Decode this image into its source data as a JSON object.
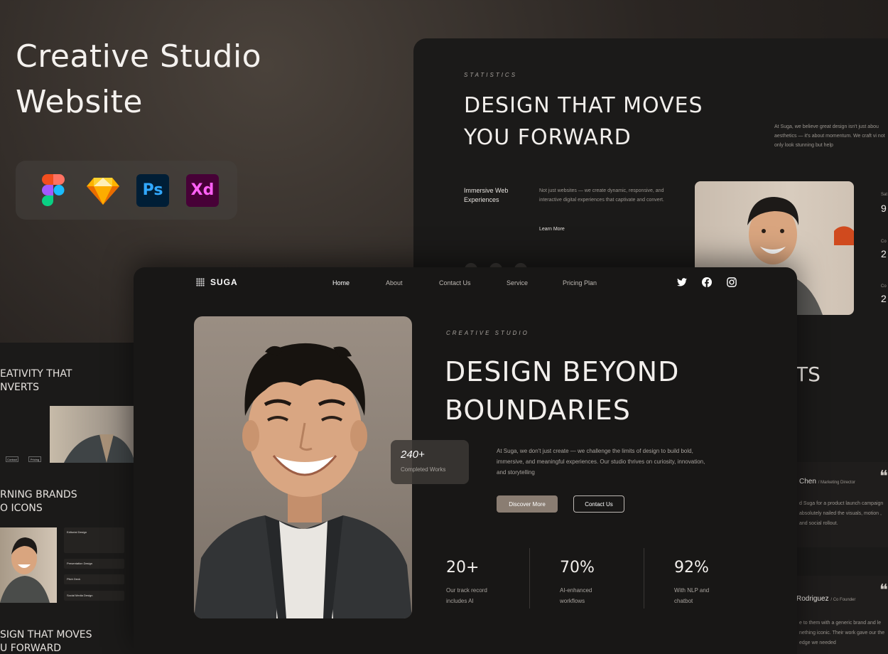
{
  "hero": {
    "title_line1": "Creative Studio",
    "title_line2": "Website"
  },
  "tools": [
    {
      "name": "figma-icon"
    },
    {
      "name": "sketch-icon"
    },
    {
      "name": "photoshop-icon",
      "label": "Ps"
    },
    {
      "name": "xd-icon",
      "label": "Xd"
    }
  ],
  "back_card": {
    "eyebrow": "STATISTICS",
    "title_line1": "DESIGN THAT MOVES",
    "title_line2": "YOU FORWARD",
    "intro": "At Suga, we believe great design isn't just abou aesthetics — it's about momentum. We craft vi not only look stunning but help",
    "feature_title": "Immersive Web Experiences",
    "feature_desc": "Not just websites — we create dynamic, responsive, and interactive digital experiences that captivate and convert.",
    "learn_more": "Learn More",
    "side_stats": [
      {
        "label": "Sat",
        "value": "9"
      },
      {
        "label": "Co",
        "value": "2"
      },
      {
        "label": "Co",
        "value": "2"
      }
    ]
  },
  "left_card": {
    "head1_line1": "EATIVITY THAT",
    "head1_line2": "NVERTS",
    "head2_line1": "RNING BRANDS",
    "head2_line2": "O ICONS",
    "head3_line1": "SIGN THAT MOVES",
    "head3_line2": "U FORWARD",
    "services": [
      "Editorial Design",
      "Presentation Design",
      "Pitch Deck",
      "Social Media Design"
    ],
    "btn_a": "Contact",
    "btn_b": "Pricing"
  },
  "right_card": {
    "heading_fragment": "TS",
    "t1_name": "Chen",
    "t1_role": "/ Marketing Director",
    "t1_text": "d Suga for a product launch campaign absolutely nailed the visuals, motion , and social rollout.",
    "t2_name": "Rodriguez",
    "t2_role": "/ Co Founder",
    "t2_text": "e to them with a generic brand and le nething iconic. Their work gave our the edge we needed"
  },
  "front_card": {
    "logo": "SUGA",
    "nav": [
      "Home",
      "About",
      "Contact Us",
      "Service",
      "Pricing Plan"
    ],
    "badge_value": "240+",
    "badge_label": "Completed Works",
    "eyebrow": "CREATIVE STUDIO",
    "title_line1": "DESIGN BEYOND",
    "title_line2": "BOUNDARIES",
    "description": "At Suga, we don't just create — we challenge the limits of design to build bold, immersive, and meaningful experiences. Our studio thrives on curiosity, innovation, and storytelling",
    "cta_primary": "Discover More",
    "cta_secondary": "Contact Us",
    "stats": [
      {
        "value": "20+",
        "desc_line1": "Our track record",
        "desc_line2": "includes AI"
      },
      {
        "value": "70%",
        "desc_line1": "AI-enhanced",
        "desc_line2": "workflows"
      },
      {
        "value": "92%",
        "desc_line1": "With NLP and",
        "desc_line2": "chatbot"
      }
    ]
  },
  "colors": {
    "accent": "#8a7d72",
    "card": "#181716",
    "text_muted": "#a8a39e"
  }
}
